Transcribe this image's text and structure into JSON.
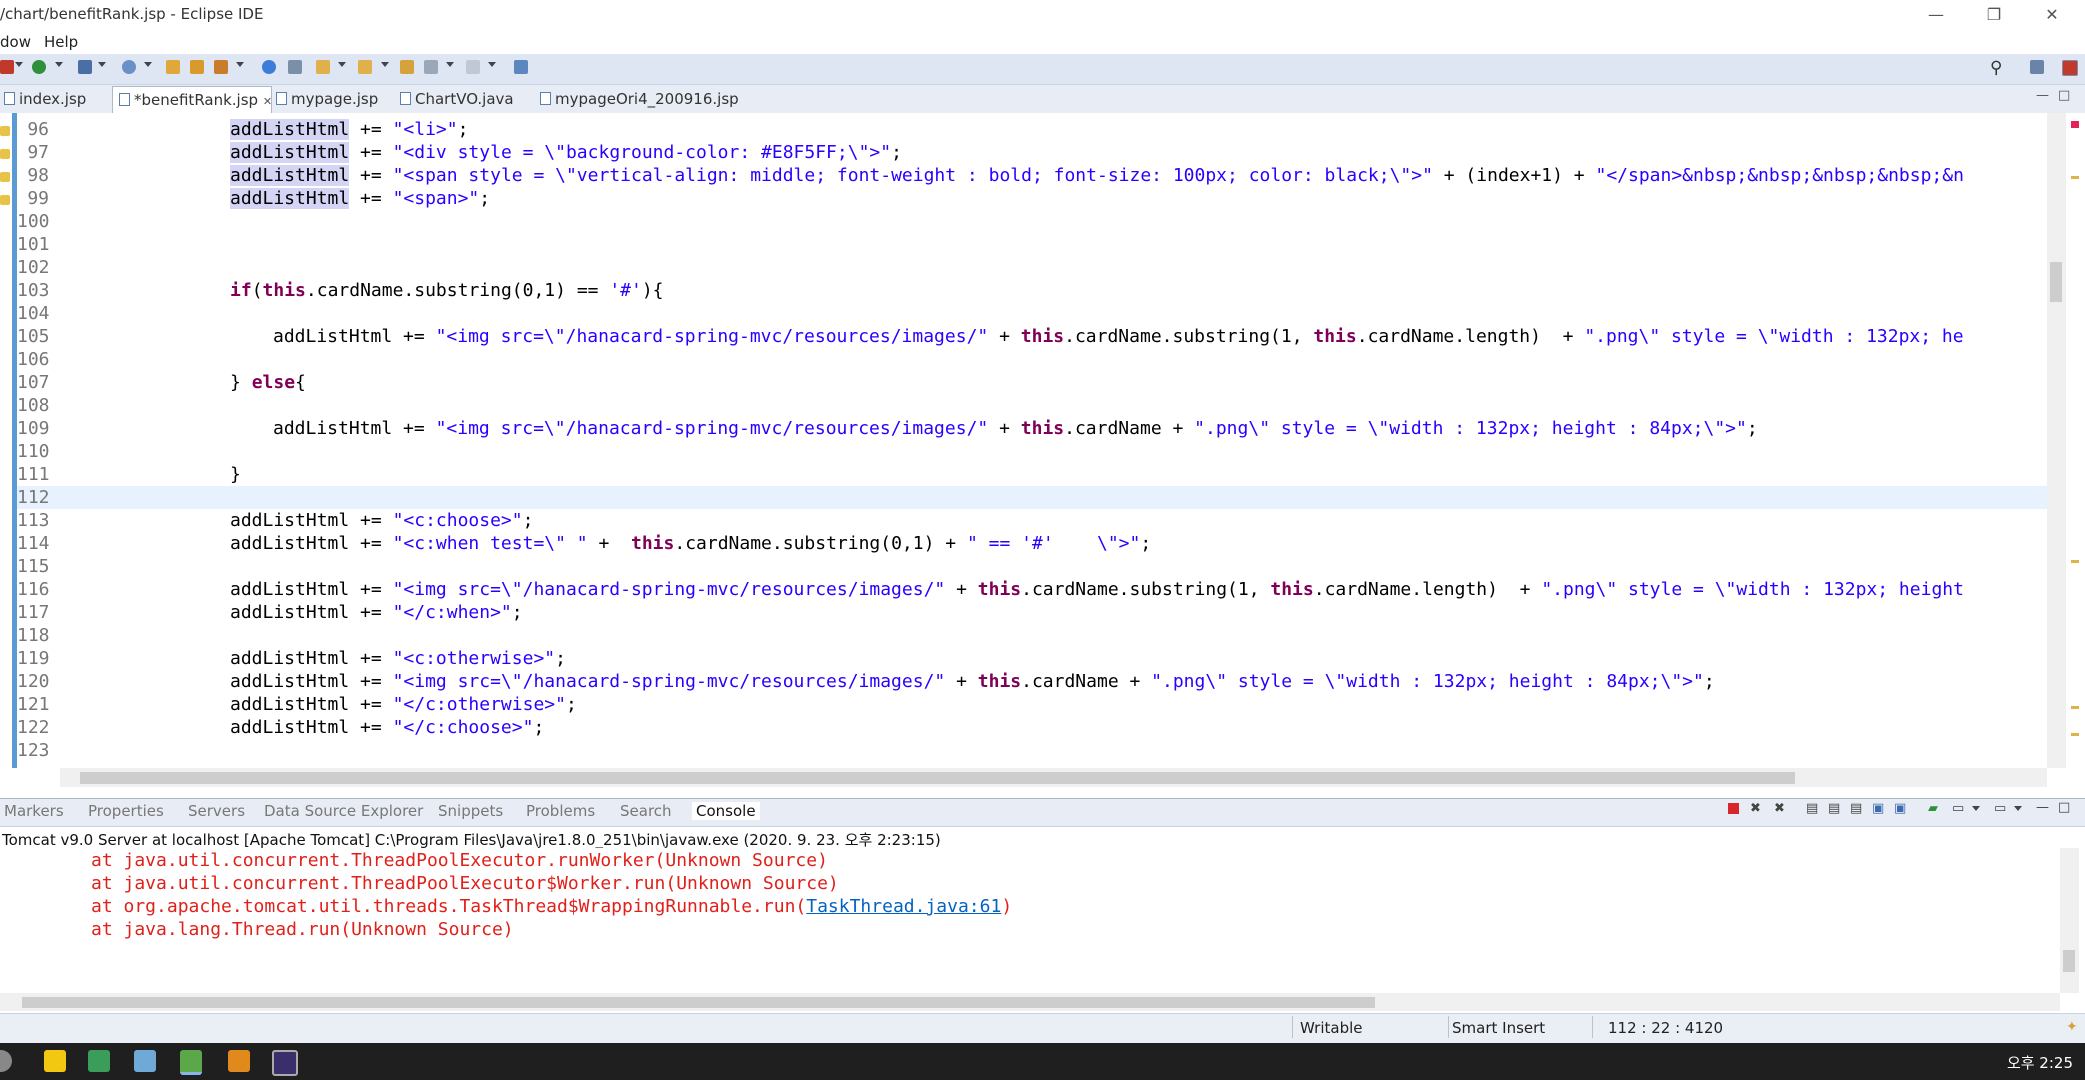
{
  "window": {
    "title": "/chart/benefitRank.jsp - Eclipse IDE",
    "minimize": "—",
    "maximize": "❐",
    "close": "✕"
  },
  "menu": [
    "dow",
    "Help"
  ],
  "editor_tabs": [
    {
      "label": "index.jsp",
      "active": false
    },
    {
      "label": "*benefitRank.jsp",
      "active": true,
      "close": "✕"
    },
    {
      "label": "mypage.jsp",
      "active": false
    },
    {
      "label": "ChartVO.java",
      "active": false
    },
    {
      "label": "mypageOri4_200916.jsp",
      "active": false
    }
  ],
  "code_lines": [
    {
      "num": "96",
      "text": "addListHtml += \"<li>\";"
    },
    {
      "num": "97",
      "text": "addListHtml += \"<div style = \\\"background-color: #E8F5FF;\\\">\";"
    },
    {
      "num": "98",
      "text": "addListHtml += \"<span style = \\\"vertical-align: middle; font-weight : bold; font-size: 100px; color: black;\\\">\" + (index+1) + \"</span>&nbsp;&nbsp;&nbsp;&nbsp;&n"
    },
    {
      "num": "99",
      "text": "addListHtml += \"<span>\";"
    },
    {
      "num": "100",
      "text": ""
    },
    {
      "num": "101",
      "text": ""
    },
    {
      "num": "102",
      "text": ""
    },
    {
      "num": "103",
      "text": "if(this.cardName.substring(0,1) == '#'){"
    },
    {
      "num": "104",
      "text": ""
    },
    {
      "num": "105",
      "text": "addListHtml += \"<img src=\\\"/hanacard-spring-mvc/resources/images/\" + this.cardName.substring(1, this.cardName.length)  + \".png\\\" style = \\\"width : 132px; he"
    },
    {
      "num": "106",
      "text": ""
    },
    {
      "num": "107",
      "text": "} else{"
    },
    {
      "num": "108",
      "text": ""
    },
    {
      "num": "109",
      "text": "addListHtml += \"<img src=\\\"/hanacard-spring-mvc/resources/images/\" + this.cardName + \".png\\\" style = \\\"width : 132px; height : 84px;\\\">\";"
    },
    {
      "num": "110",
      "text": ""
    },
    {
      "num": "111",
      "text": "}"
    },
    {
      "num": "112",
      "text": ""
    },
    {
      "num": "113",
      "text": "addListHtml += \"<c:choose>\";"
    },
    {
      "num": "114",
      "text": "addListHtml += \"<c:when test=\\\" \" +  this.cardName.substring(0,1) + \" == '#'    \\\">\";"
    },
    {
      "num": "115",
      "text": ""
    },
    {
      "num": "116",
      "text": "addListHtml += \"<img src=\\\"/hanacard-spring-mvc/resources/images/\" + this.cardName.substring(1, this.cardName.length)  + \".png\\\" style = \\\"width : 132px; height"
    },
    {
      "num": "117",
      "text": "addListHtml += \"</c:when>\";"
    },
    {
      "num": "118",
      "text": ""
    },
    {
      "num": "119",
      "text": "addListHtml += \"<c:otherwise>\";"
    },
    {
      "num": "120",
      "text": "addListHtml += \"<img src=\\\"/hanacard-spring-mvc/resources/images/\" + this.cardName + \".png\\\" style = \\\"width : 132px; height : 84px;\\\">\";"
    },
    {
      "num": "121",
      "text": "addListHtml += \"</c:otherwise>\";"
    },
    {
      "num": "122",
      "text": "addListHtml += \"</c:choose>\";"
    },
    {
      "num": "123",
      "text": ""
    }
  ],
  "view_tabs": [
    "Markers",
    "Properties",
    "Servers",
    "Data Source Explorer",
    "Snippets",
    "Problems",
    "Search",
    "Console"
  ],
  "console": {
    "description": "Tomcat v9.0 Server at localhost [Apache Tomcat] C:\\Program Files\\Java\\jre1.8.0_251\\bin\\javaw.exe  (2020. 9. 23. 오후 2:23:15)",
    "lines": [
      {
        "text": "at java.util.concurrent.ThreadPoolExecutor.runWorker(Unknown Source)"
      },
      {
        "text": "at java.util.concurrent.ThreadPoolExecutor$Worker.run(Unknown Source)"
      },
      {
        "text": "at org.apache.tomcat.util.threads.TaskThread$WrappingRunnable.run(",
        "link": "TaskThread.java:61",
        "after": ")"
      },
      {
        "text": "at java.lang.Thread.run(Unknown Source)"
      }
    ]
  },
  "status": {
    "writable": "Writable",
    "insert_mode": "Smart Insert",
    "position": "112 : 22 : 4120"
  },
  "taskbar": {
    "clock": "오후 2:25"
  },
  "colors": {
    "keyword": "#7f0055",
    "string": "#2a00ff",
    "console_error": "#e0201a",
    "link": "#0563c1"
  }
}
